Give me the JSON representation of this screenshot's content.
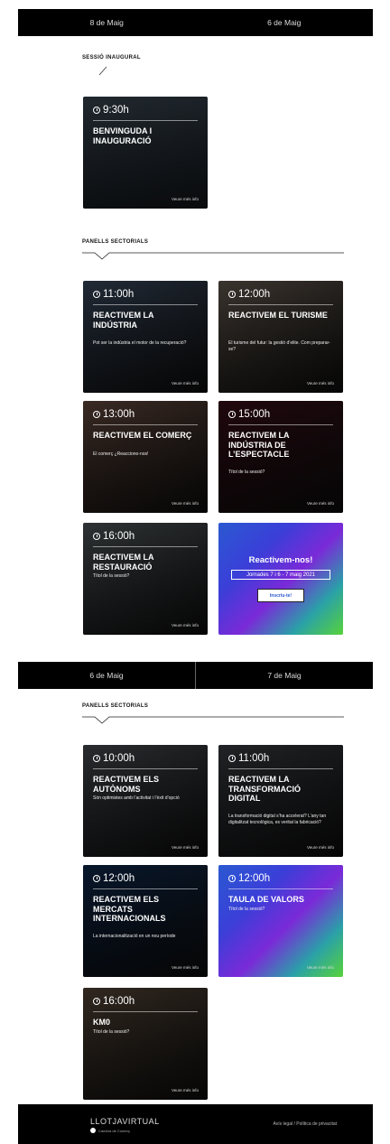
{
  "day_tabs_top": {
    "left": "8 de Maig",
    "right": "6 de Maig"
  },
  "inaugural": {
    "label": "SESSIÓ INAUGURAL",
    "card": {
      "time": "9:30h",
      "title": "BENVINGUDA I INAUGURACIÓ",
      "more": "Veure més info"
    }
  },
  "panels_1": {
    "label": "PANELLS SECTORIALS",
    "cards": [
      {
        "time": "11:00h",
        "title": "REACTIVEM LA INDÚSTRIA",
        "subtitle": "Pot ser la indústria el motor de la recuperació?",
        "more": "Veure més info",
        "color": "#3d4d63"
      },
      {
        "time": "12:00h",
        "title": "REACTIVEM EL TURISME",
        "subtitle": "El turisme del futur: la gestió d’elite. Com preparar-se?",
        "more": "Veure més info",
        "color": "#6b5f54"
      },
      {
        "time": "13:00h",
        "title": "REACTIVEM EL COMERÇ",
        "subtitle": "El comerç ¿Reacciono-nos!",
        "more": "Veure més info",
        "color": "#6a4d41"
      },
      {
        "time": "15:00h",
        "title": "REACTIVEM LA INDÚSTRIA DE L’ESPECTACLE",
        "subtitle": "Títol de la sessió?",
        "more": "Veure més info",
        "color": "#3a0d18"
      },
      {
        "time": "16:00h",
        "title": "REACTIVEM LA RESTAURACIÓ",
        "subtitle": "Títol de la sessió?",
        "more": "Veure més info",
        "color": "#555c60"
      }
    ]
  },
  "promo": {
    "title": "Reactivem-nos!",
    "dates": "Jornades 7 i 6 - 7 maig 2021",
    "button": "Inscriu-te!"
  },
  "day_tabs_bottom": {
    "left": "6 de Maig",
    "right": "7 de Maig"
  },
  "panels_2": {
    "label": "PANELLS SECTORIALS",
    "cards": [
      {
        "time": "10:00h",
        "title": "REACTIVEM ELS AUTÒNOMS",
        "subtitle": "Són optimistes amb l’activitat i l’èxit d’opció",
        "more": "Veure més info",
        "color": "#4b4f55"
      },
      {
        "time": "11:00h",
        "title": "REACTIVEM LA TRANSFORMACIÓ DIGITAL",
        "subtitle": "La transformació digital s’ha accelerat? L’any tan digitalitzat tecnològica, es veritat la fabricació?",
        "more": "Veure més info",
        "color": "#3c3f45"
      },
      {
        "time": "12:00h",
        "title": "REACTIVEM ELS MERCATS INTERNACIONALS",
        "subtitle": "La internacionalització en un nou període",
        "more": "Veure més info",
        "color": "#0f2a50"
      },
      {
        "time": "12:00h",
        "title": "TAULA DE VALORS",
        "subtitle": "Títol de la sessió?",
        "more": "Veure més info",
        "color": "promo"
      },
      {
        "time": "16:00h",
        "title": "KM0",
        "subtitle": "Títol de la sessió?",
        "more": "Veure més info",
        "color": "#5a4a3a"
      }
    ]
  },
  "footer": {
    "logo": "LLOTJAVIRTUAL",
    "logo_sub": "Cambra de Comerç",
    "text": "Avís legal / Política de privacitat"
  }
}
